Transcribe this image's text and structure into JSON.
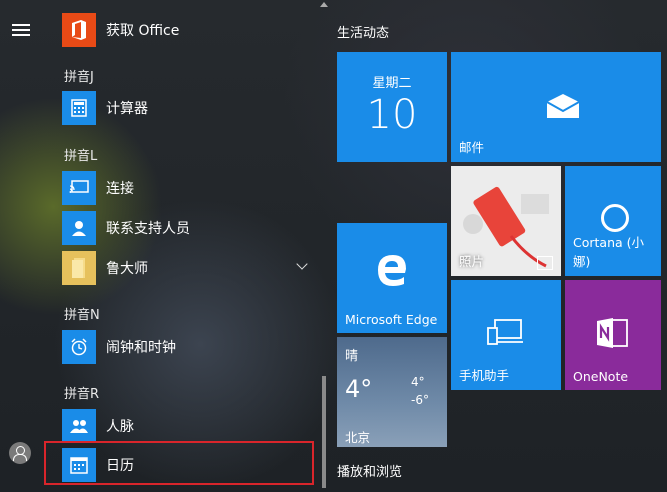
{
  "applist": {
    "get_office": "获取 Office",
    "header_j": "拼音J",
    "calculator": "计算器",
    "header_l": "拼音L",
    "connect": "连接",
    "contact_support": "联系支持人员",
    "ludashi": "鲁大师",
    "header_n": "拼音N",
    "alarms": "闹钟和时钟",
    "header_r": "拼音R",
    "people": "人脉",
    "calendar": "日历"
  },
  "tiles": {
    "group1": "生活动态",
    "calendar_day": "星期二",
    "calendar_date": "10",
    "mail": "邮件",
    "photos": "照片",
    "cortana": "Cortana (小娜)",
    "edge": "Microsoft Edge",
    "weather_cond": "晴",
    "weather_temp": "4°",
    "weather_high": "4°",
    "weather_low": "-6°",
    "weather_city": "北京",
    "phone": "手机助手",
    "onenote": "OneNote",
    "group2": "播放和浏览"
  },
  "colors": {
    "tile_blue": "#1a8ce8",
    "onenote_purple": "#8a2b9b",
    "office_orange": "#e84a16",
    "highlight_red": "#d9252b"
  }
}
